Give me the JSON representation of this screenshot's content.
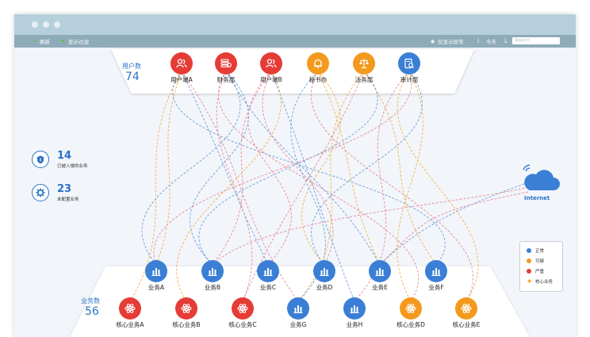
{
  "toolbar": {
    "refresh_label": "刷新",
    "filter_label": "显示过滤",
    "anomaly_label": "仅显示异常",
    "period_label": "今天",
    "search_placeholder": "Search"
  },
  "users_panel": {
    "label": "用户数",
    "count": "74"
  },
  "services_panel": {
    "label": "业务数",
    "count": "56"
  },
  "top_nodes": [
    {
      "label": "用户端A",
      "icon": "users-icon",
      "status": "严重"
    },
    {
      "label": "财务部",
      "icon": "coins-icon",
      "status": "严重"
    },
    {
      "label": "用户端B",
      "icon": "users-icon",
      "status": "严重"
    },
    {
      "label": "秘书办",
      "icon": "bell-icon",
      "status": "可疑"
    },
    {
      "label": "法务部",
      "icon": "scale-icon",
      "status": "可疑"
    },
    {
      "label": "审计部",
      "icon": "audit-icon",
      "status": "正常"
    }
  ],
  "services_row1": [
    {
      "label": "业务A",
      "status": "正常"
    },
    {
      "label": "业务B",
      "status": "正常"
    },
    {
      "label": "业务C",
      "status": "正常"
    },
    {
      "label": "业务D",
      "status": "正常"
    },
    {
      "label": "业务E",
      "status": "正常"
    },
    {
      "label": "业务F",
      "status": "正常"
    }
  ],
  "services_row2": [
    {
      "label": "核心业务A",
      "status": "严重"
    },
    {
      "label": "核心业务B",
      "status": "严重"
    },
    {
      "label": "核心业务C",
      "status": "严重"
    },
    {
      "label": "业务G",
      "status": "正常"
    },
    {
      "label": "业务H",
      "status": "正常"
    },
    {
      "label": "核心业务D",
      "status": "可疑"
    },
    {
      "label": "核心业务E",
      "status": "可疑"
    }
  ],
  "stats": [
    {
      "value": "14",
      "label": "已被入侵的业务",
      "icon": "shield-icon"
    },
    {
      "value": "23",
      "label": "未配置业务",
      "icon": "gear-icon"
    }
  ],
  "internet": {
    "label": "Internet",
    "icon": "cloud-wifi-icon"
  },
  "legend": [
    {
      "label": "正常",
      "color": "#3a7fd5",
      "shape": "dot"
    },
    {
      "label": "可疑",
      "color": "#f39a1e",
      "shape": "dot"
    },
    {
      "label": "严重",
      "color": "#e63c36",
      "shape": "dot"
    },
    {
      "label": "核心业务",
      "color": "#f39a1e",
      "shape": "star"
    }
  ],
  "colors": {
    "normal": "#3a7fd5",
    "suspicious": "#f39a1e",
    "critical": "#e63c36",
    "accent": "#2a72c6"
  }
}
